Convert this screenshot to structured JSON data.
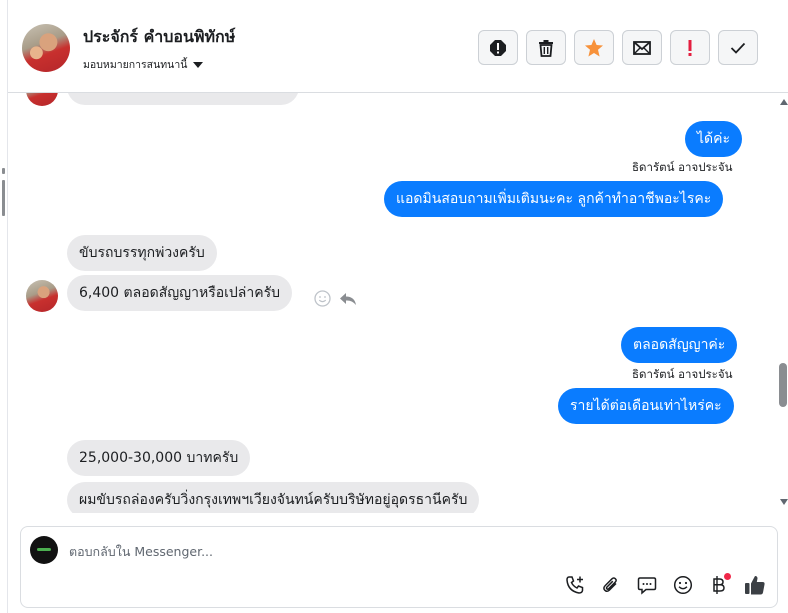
{
  "header": {
    "contact_name": "ประจักร์ คำบอนพิทักษ์",
    "assign_label": "มอบหมายการสนทนานี้"
  },
  "actions": [
    {
      "name": "report-button",
      "icon": "exclamation-circle-icon"
    },
    {
      "name": "delete-button",
      "icon": "trash-icon"
    },
    {
      "name": "star-button",
      "icon": "star-icon"
    },
    {
      "name": "mark-unread-button",
      "icon": "envelope-icon"
    },
    {
      "name": "follow-up-button",
      "icon": "exclamation-icon"
    },
    {
      "name": "done-button",
      "icon": "check-icon"
    }
  ],
  "messages": [
    {
      "id": "m0",
      "direction": "in",
      "text": ""
    },
    {
      "id": "m1",
      "direction": "out",
      "text": "ได้ค่ะ"
    },
    {
      "id": "m2",
      "direction": "out",
      "sender": "ธิดารัตน์ อาจประจัน",
      "text": "แอดมินสอบถามเพิ่มเติมนะคะ ลูกค้าทำอาชีพอะไรคะ"
    },
    {
      "id": "m3",
      "direction": "in",
      "text": "ขับรถบรรทุกพ่วงครับ"
    },
    {
      "id": "m4",
      "direction": "in",
      "text": "6,400 ตลอดสัญญาหรือเปล่าครับ"
    },
    {
      "id": "m5",
      "direction": "out",
      "text": "ตลอดสัญญาค่ะ"
    },
    {
      "id": "m6",
      "direction": "out",
      "sender": "ธิดารัตน์ อาจประจัน",
      "text": "รายได้ต่อเดือนเท่าไหร่คะ"
    },
    {
      "id": "m7",
      "direction": "in",
      "text": "25,000-30,000 บาทครับ"
    },
    {
      "id": "m8",
      "direction": "in",
      "text": "ผมขับรถล่องครับวิ่งกรุงเทพฯเวียงจันทน์ครับบริษัทอยู่อุดรธานีครับ"
    }
  ],
  "composer": {
    "placeholder": "ตอบกลับใน Messenger...",
    "value": "",
    "tools": [
      "phone-add-icon",
      "paperclip-icon",
      "chat-template-icon",
      "emoji-icon",
      "baht-icon",
      "thumbs-up-icon"
    ]
  },
  "colors": {
    "outgoing_bubble": "#0a7cff",
    "incoming_bubble": "#e9e9eb",
    "star": "#f7923b",
    "alert": "#e41e3f",
    "thumbs_up": "#3b3f44"
  }
}
